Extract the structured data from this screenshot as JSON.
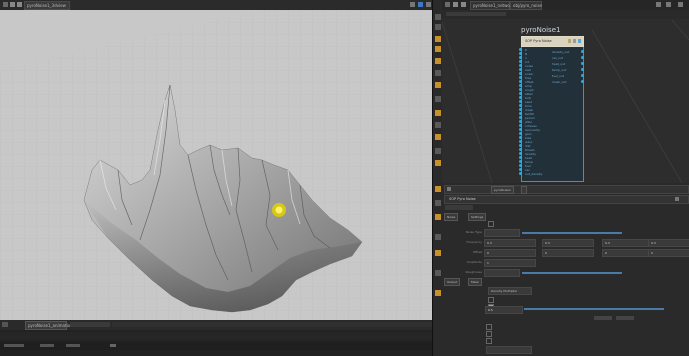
{
  "viewport": {
    "tab_label": "pyroNoise1_3dview",
    "bottom_tab_label": "pyroNoise1_animation"
  },
  "network": {
    "tab_label": "pyroNoise1_network",
    "path_label": "obj/pyro_noise",
    "node_name": "pyroNoise1",
    "node_header": "SOP Pyro Noise",
    "input_ports": [
      "P",
      "N",
      "v",
      "Cd",
      "noise",
      "rest",
      "scale",
      "freq",
      "offset",
      "amp",
      "rough",
      "atten",
      "turb",
      "seed",
      "time",
      "mask",
      "fwidth",
      "period",
      "jitter",
      "octaves",
      "lacunarity",
      "gain",
      "bias",
      "warp",
      "dist",
      "thresh",
      "density",
      "heat",
      "temp",
      "fuel",
      "vel",
      "out_density"
    ],
    "output_ports": [
      "density_out",
      "vel_out",
      "heat_out",
      "temp_out",
      "fuel_out",
      "mask_out"
    ]
  },
  "params": {
    "tab_label": "pyroNoise1",
    "node_label": "SOP Pyro Noise",
    "tabs": [
      "Noise",
      "Settings"
    ],
    "rows": [
      {
        "label": "Noise Type"
      },
      {
        "label": "Frequency",
        "v": [
          "0.3",
          "0.3",
          "0.3",
          "0.3"
        ]
      },
      {
        "label": "Offset",
        "v": [
          "0",
          "0",
          "0",
          "0"
        ]
      },
      {
        "label": "Amplitude",
        "v": [
          "1"
        ]
      },
      {
        "label": "Roughness"
      }
    ],
    "section_tabs": [
      "Output",
      "Mask"
    ],
    "dropdown_value": "Density Multiplier",
    "mask_value": "0.5"
  }
}
